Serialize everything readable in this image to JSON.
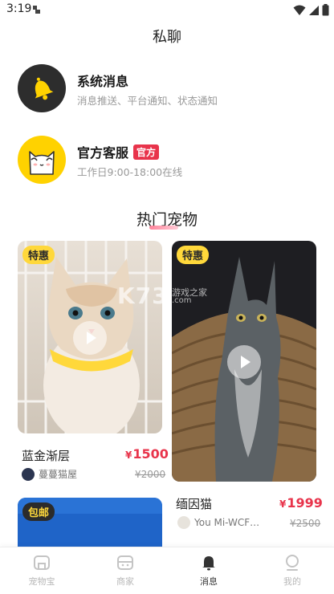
{
  "status_bar": {
    "time": "3:19"
  },
  "header": {
    "title": "私聊"
  },
  "messages": [
    {
      "title": "系统消息",
      "subtitle": "消息推送、平台通知、状态通知",
      "icon": "bell-icon"
    },
    {
      "title": "官方客服",
      "badge": "官方",
      "subtitle": "工作日9:00-18:00在线",
      "icon": "cat-mascot-icon"
    }
  ],
  "section": {
    "title": "热门宠物"
  },
  "cards": [
    {
      "tag": "特惠",
      "name": "蓝金渐层",
      "currency": "¥",
      "price": "1500",
      "shop": "蔓蔓猫屋",
      "old_price": "¥2000"
    },
    {
      "tag": "特惠",
      "name": "缅因猫",
      "currency": "¥",
      "price": "1999",
      "shop": "You Mi-WCF…",
      "old_price": "¥2500"
    },
    {
      "tag": "包邮"
    }
  ],
  "watermark": {
    "main": "K73",
    "sub": "游戏之家",
    "sub2": ".com"
  },
  "tabs": [
    {
      "label": "宠物宝",
      "icon": "home-icon"
    },
    {
      "label": "商家",
      "icon": "store-icon"
    },
    {
      "label": "消息",
      "icon": "bell-icon",
      "active": true
    },
    {
      "label": "我的",
      "icon": "profile-icon"
    }
  ],
  "colors": {
    "accent": "#e8344b",
    "tag": "#ffd83b",
    "mascot": "#ffd200"
  }
}
